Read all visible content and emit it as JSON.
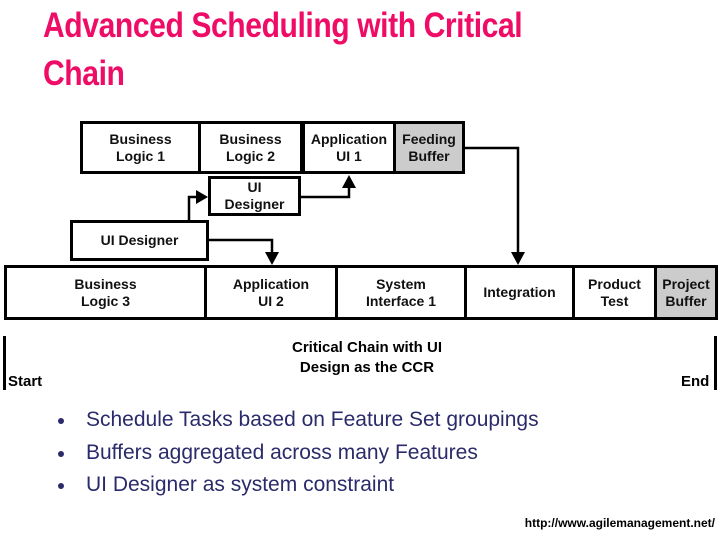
{
  "slide": {
    "title_lines": [
      "Advanced Scheduling with Critical",
      "Chain"
    ],
    "title_color": "#ee0c66"
  },
  "diagram": {
    "feeding_chain": [
      {
        "id": "business-logic-1",
        "label": "Business\nLogic 1",
        "type": "task"
      },
      {
        "id": "business-logic-2",
        "label": "Business\nLogic 2",
        "type": "task"
      },
      {
        "id": "application-ui-1",
        "label": "Application\nUI 1",
        "type": "task"
      },
      {
        "id": "feeding-buffer",
        "label": "Feeding\nBuffer",
        "type": "buffer"
      }
    ],
    "resources": [
      {
        "id": "ui-designer-upper",
        "label": "UI\nDesigner"
      },
      {
        "id": "ui-designer-lower",
        "label": "UI Designer"
      }
    ],
    "critical_chain": [
      {
        "id": "business-logic-3",
        "label": "Business\nLogic 3",
        "type": "task"
      },
      {
        "id": "application-ui-2",
        "label": "Application\nUI 2",
        "type": "task"
      },
      {
        "id": "system-interface-1",
        "label": "System\nInterface 1",
        "type": "task"
      },
      {
        "id": "integration",
        "label": "Integration",
        "type": "task"
      },
      {
        "id": "product-test",
        "label": "Product\nTest",
        "type": "task"
      },
      {
        "id": "project-buffer",
        "label": "Project\nBuffer",
        "type": "buffer"
      }
    ],
    "links": [
      {
        "from": "ui-designer-lower",
        "to": "ui-designer-upper"
      },
      {
        "from": "ui-designer-upper",
        "to": "application-ui-1"
      },
      {
        "from": "ui-designer-lower",
        "to": "application-ui-2"
      },
      {
        "from": "feeding-buffer",
        "to": "integration"
      }
    ],
    "start_label": "Start",
    "end_label": "End",
    "caption": "Critical Chain with UI\nDesign as the CCR",
    "buffer_color": "#cccccc"
  },
  "bullets": [
    "Schedule Tasks based on Feature Set groupings",
    "Buffers aggregated across many Features",
    "UI Designer as system constraint"
  ],
  "source_url": "http://www.agilemanagement.net/"
}
